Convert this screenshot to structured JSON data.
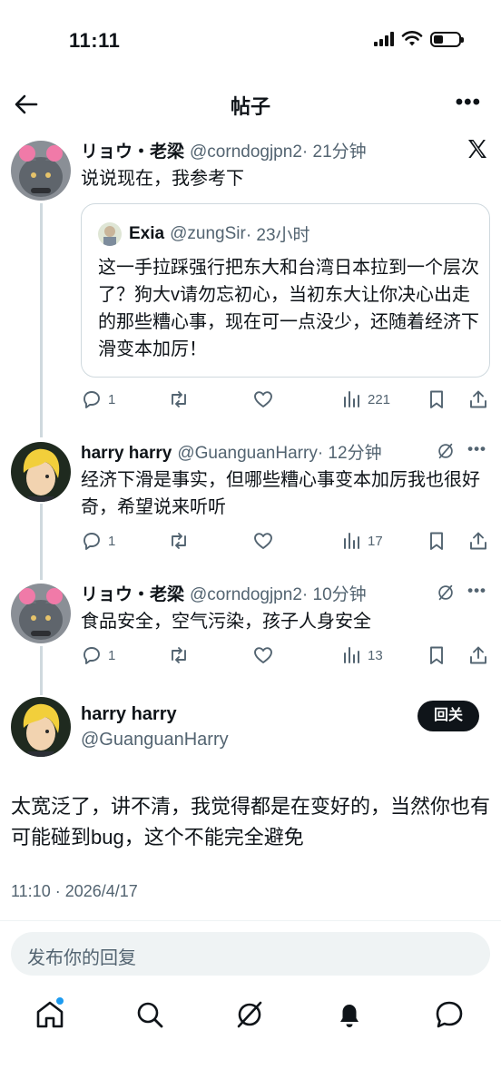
{
  "status_bar": {
    "time": "11:11"
  },
  "header": {
    "title": "帖子"
  },
  "main_tweet": {
    "name": "リョウ・老梁",
    "handle": "@corndogjpn2",
    "time": "· 21分钟",
    "text": "说说现在，我参考下"
  },
  "quote": {
    "name": "Exia",
    "handle": "@zungSir",
    "time": "· 23小时",
    "text": "这一手拉踩强行把东大和台湾日本拉到一个层次了？狗大v请勿忘初心，当初东大让你决心出走的那些糟心事，现在可一点没少，还随着经济下滑变本加厉！"
  },
  "main_actions": {
    "replies": "1",
    "views": "221"
  },
  "reply1": {
    "name": "harry harry",
    "handle": "@GuanguanHarry",
    "time": "· 12分钟",
    "text": "经济下滑是事实，但哪些糟心事变本加厉我也很好奇，希望说来听听",
    "replies": "1",
    "views": "17"
  },
  "reply2": {
    "name": "リョウ・老梁",
    "handle": "@corndogjpn2",
    "time": "· 10分钟",
    "text": "食品安全，空气污染，孩子人身安全",
    "replies": "1",
    "views": "13"
  },
  "focus_post": {
    "name": "harry harry",
    "handle": "@GuanguanHarry",
    "follow_label": "回关",
    "text": "太宽泛了，讲不清，我觉得都是在变好的，当然你也有可能碰到bug，这个不能完全避免",
    "timestamp": "11:10 · 2026/4/17"
  },
  "composer": {
    "placeholder": "发布你的回复"
  },
  "colors": {
    "text": "#0f1419",
    "secondary": "#536471",
    "border": "#cfd9de",
    "accent": "#1d9bf0"
  },
  "icons": [
    "back-arrow-icon",
    "more-icon",
    "x-logo-icon",
    "reply-icon",
    "repost-icon",
    "like-icon",
    "views-icon",
    "bookmark-icon",
    "share-icon",
    "grok-icon",
    "home-icon",
    "search-icon",
    "bell-icon",
    "messages-icon"
  ]
}
